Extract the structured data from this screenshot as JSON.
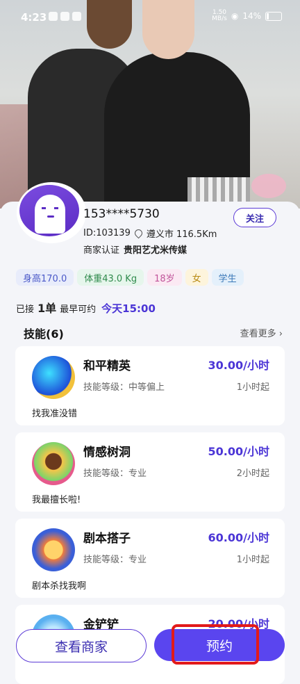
{
  "status_bar": {
    "time": "4:23",
    "speed": "1.50\nMB/s",
    "battery": "14%"
  },
  "profile": {
    "username": "153****5730",
    "follow_label": "关注",
    "id_text": "ID:103139",
    "location": "遵义市 116.5Km",
    "cert_label": "商家认证",
    "cert_name": "贵阳艺尤米传媒"
  },
  "tags": [
    {
      "label": "身高170.0",
      "bg": "#e8ecfb",
      "color": "#4a58c8"
    },
    {
      "label": "体重43.0 Kg",
      "bg": "#e6f6ec",
      "color": "#2f8a4c"
    },
    {
      "label": "18岁",
      "bg": "#fbe9f3",
      "color": "#c1549a"
    },
    {
      "label": "女",
      "bg": "#fdf4dc",
      "color": "#b88a14"
    },
    {
      "label": "学生",
      "bg": "#e4f0fb",
      "color": "#3a78b8"
    }
  ],
  "orders": {
    "prefix": "已接",
    "count": "1单",
    "earliest": "最早可约",
    "today": "今天15:00"
  },
  "skills_section": {
    "title": "技能(6)",
    "more": "查看更多 ›"
  },
  "skills": [
    {
      "name": "和平精英",
      "price": "30.00/小时",
      "level": "技能等级：中等偏上",
      "min": "1小时起",
      "desc": "找我准没错"
    },
    {
      "name": "情感树洞",
      "price": "50.00/小时",
      "level": "技能等级：专业",
      "min": "2小时起",
      "desc": "我最擅长啦!"
    },
    {
      "name": "剧本搭子",
      "price": "60.00/小时",
      "level": "技能等级：专业",
      "min": "1小时起",
      "desc": "剧本杀找我啊"
    },
    {
      "name": "金铲铲",
      "price": "20.00/小时",
      "level": "",
      "min": "",
      "desc": ""
    }
  ],
  "bottom_bar": {
    "shop_label": "查看商家",
    "book_label": "预约"
  }
}
